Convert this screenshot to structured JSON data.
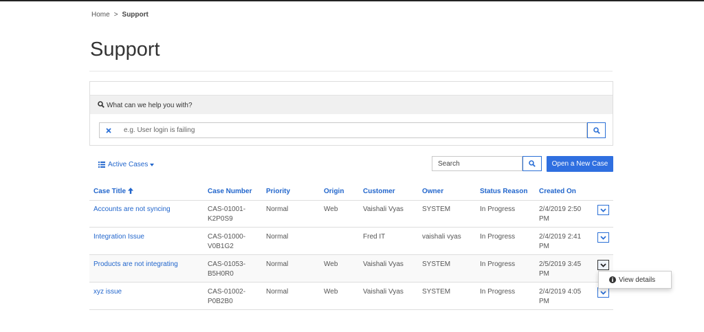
{
  "breadcrumb": {
    "home": "Home",
    "separator": ">",
    "current": "Support"
  },
  "page": {
    "title": "Support"
  },
  "knowledge_search": {
    "question": "What can we help you with?",
    "placeholder": "e.g. User login is failing"
  },
  "grid": {
    "view_label": "Active Cases",
    "search_placeholder": "Search",
    "new_case_label": "Open a New Case",
    "columns": [
      "Case Title",
      "Case Number",
      "Priority",
      "Origin",
      "Customer",
      "Owner",
      "Status Reason",
      "Created On"
    ],
    "sort": {
      "column": "Case Title",
      "direction": "ascending"
    },
    "rows": [
      {
        "title": "Accounts are not syncing",
        "case_number": "CAS-01001-K2P0S9",
        "priority": "Normal",
        "origin": "Web",
        "customer": "Vaishali Vyas",
        "owner": "SYSTEM",
        "status": "In Progress",
        "created": "2/4/2019 2:50 PM"
      },
      {
        "title": "Integration Issue",
        "case_number": "CAS-01000-V0B1G2",
        "priority": "Normal",
        "origin": "",
        "customer": "Fred IT",
        "owner": "vaishali vyas",
        "status": "In Progress",
        "created": "2/4/2019 2:41 PM"
      },
      {
        "title": "Products are not integrating",
        "case_number": "CAS-01053-B5H0R0",
        "priority": "Normal",
        "origin": "Web",
        "customer": "Vaishali Vyas",
        "owner": "SYSTEM",
        "status": "In Progress",
        "created": "2/5/2019 3:45 PM"
      },
      {
        "title": "xyz issue",
        "case_number": "CAS-01002-P0B2B0",
        "priority": "Normal",
        "origin": "Web",
        "customer": "Vaishali Vyas",
        "owner": "SYSTEM",
        "status": "In Progress",
        "created": "2/4/2019 4:05 PM"
      }
    ],
    "row_menu": {
      "view_details": "View details"
    }
  },
  "icons": {
    "search": "search-icon",
    "clear": "close-icon",
    "list": "list-icon",
    "sort": "arrow-up-icon",
    "row_action": "chevron-down-icon",
    "info": "info-circle-icon"
  },
  "colors": {
    "accent": "#2266cc",
    "primary_button": "#2f6fe0",
    "panel_header": "#f0f0f0"
  }
}
